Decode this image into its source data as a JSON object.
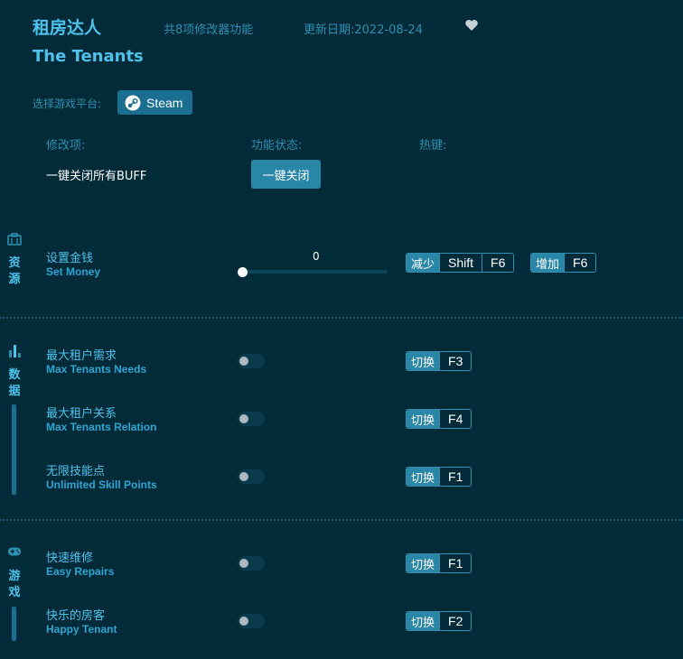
{
  "header": {
    "title_cn": "租房达人",
    "feature_count": "共8项修改器功能",
    "update_date": "更新日期:2022-08-24",
    "title_en": "The Tenants",
    "platform_label": "选择游戏平台:",
    "platform_button": "Steam"
  },
  "columns": {
    "mod": "修改项:",
    "status": "功能状态:",
    "hotkey": "热键:"
  },
  "global": {
    "label": "一键关闭所有BUFF",
    "button": "一键关闭"
  },
  "categories": {
    "resources": "资源",
    "data": "数据",
    "game": "游戏"
  },
  "items": {
    "money": {
      "cn": "设置金钱",
      "en": "Set Money",
      "value": "0",
      "dec_label": "减少",
      "dec_keys": [
        "Shift",
        "F6"
      ],
      "inc_label": "增加",
      "inc_keys": [
        "F6"
      ]
    },
    "needs": {
      "cn": "最大租户需求",
      "en": "Max Tenants Needs",
      "label": "切换",
      "key": "F3"
    },
    "relation": {
      "cn": "最大租户关系",
      "en": "Max Tenants Relation",
      "label": "切换",
      "key": "F4"
    },
    "skill": {
      "cn": "无限技能点",
      "en": "Unlimited Skill Points",
      "label": "切换",
      "key": "F1"
    },
    "repairs": {
      "cn": "快速维修",
      "en": "Easy Repairs",
      "label": "切换",
      "key": "F1"
    },
    "happy": {
      "cn": "快乐的房客",
      "en": "Happy Tenant",
      "label": "切换",
      "key": "F2"
    }
  },
  "colors": {
    "background": "#022b3a",
    "accent": "#4ec2ea",
    "button": "#2a86a6"
  }
}
